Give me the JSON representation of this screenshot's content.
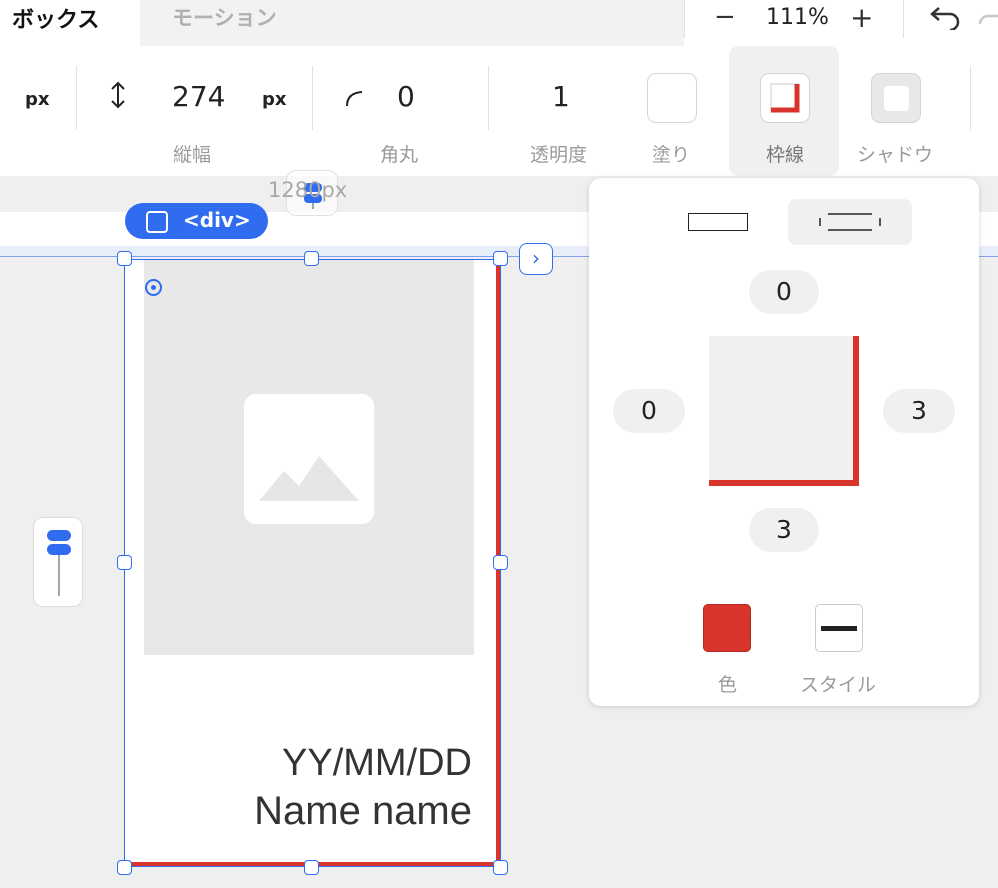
{
  "tabs": {
    "active": "ボックス",
    "inactive": "モーション"
  },
  "zoom": {
    "minus": "−",
    "value": "111%",
    "plus": "+"
  },
  "toolbar": {
    "width_unit": "px",
    "height_value": "274",
    "height_unit": "px",
    "height_label": "縦幅",
    "radius_value": "0",
    "radius_label": "角丸",
    "opacity_value": "1",
    "opacity_label": "透明度",
    "fill_label": "塗り",
    "border_label": "枠線",
    "shadow_label": "シャドウ"
  },
  "canvas": {
    "width_readout": "1280px",
    "element_badge": "<div>",
    "card": {
      "date": "YY/MM/DD",
      "name": "Name name"
    }
  },
  "border_panel": {
    "top": "0",
    "left": "0",
    "right": "3",
    "bottom": "3",
    "color_label": "色",
    "style_label": "スタイル",
    "color": "#d9342b"
  },
  "colors": {
    "accent": "#2f6cf0",
    "border": "#d9342b"
  }
}
